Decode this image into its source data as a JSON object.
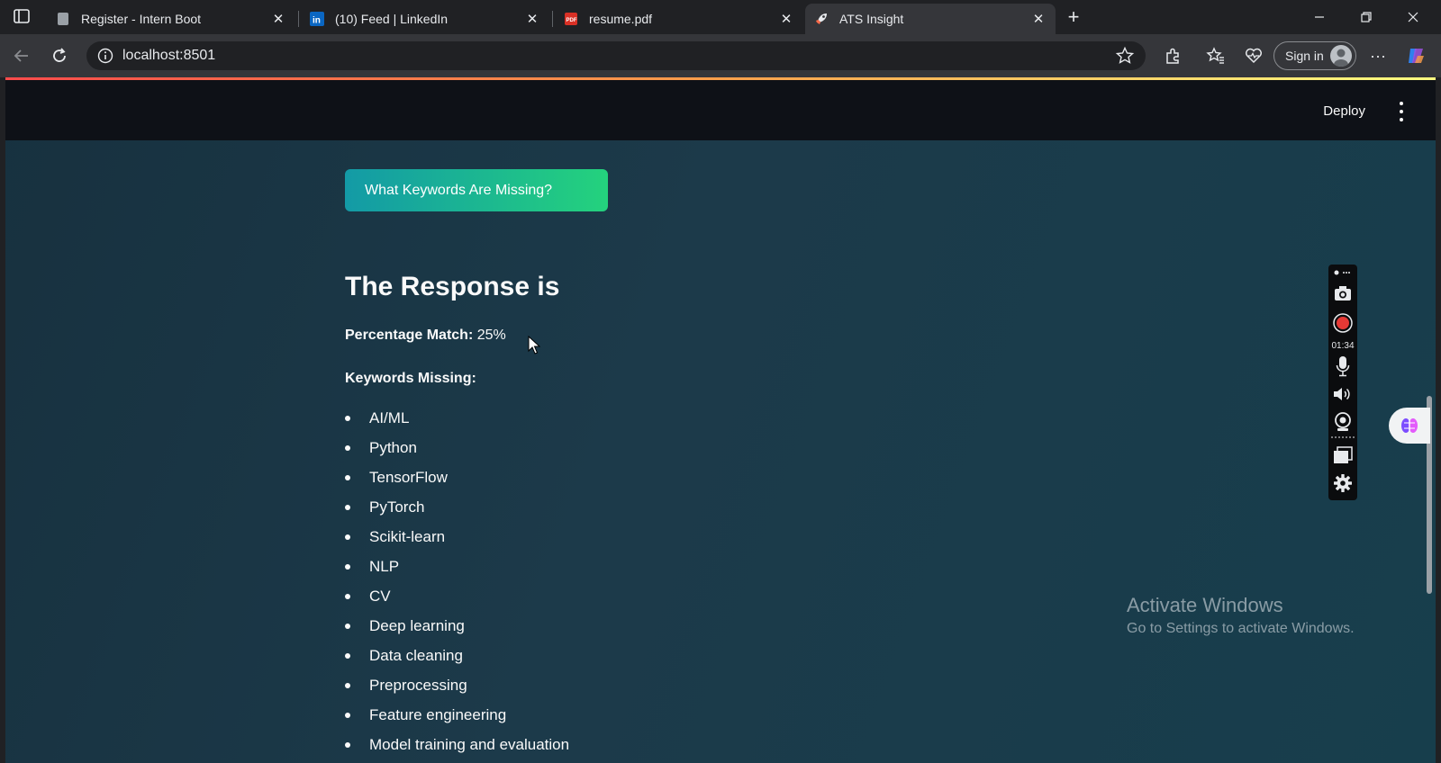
{
  "browser": {
    "tabs": [
      {
        "title": "Register - Intern Boot",
        "active": false
      },
      {
        "title": "(10) Feed | LinkedIn",
        "active": false
      },
      {
        "title": "resume.pdf",
        "active": false
      },
      {
        "title": "ATS Insight",
        "active": true
      }
    ],
    "url": "localhost:8501",
    "sign_in_label": "Sign in"
  },
  "app": {
    "deploy_label": "Deploy",
    "keywords_button": "What Keywords Are Missing?",
    "response_title": "The Response is",
    "percentage_label": "Percentage Match:",
    "percentage_value": "25%",
    "keywords_missing_label": "Keywords Missing:",
    "keywords": [
      "AI/ML",
      "Python",
      "TensorFlow",
      "PyTorch",
      "Scikit-learn",
      "NLP",
      "CV",
      "Deep learning",
      "Data cleaning",
      "Preprocessing",
      "Feature engineering",
      "Model training and evaluation"
    ]
  },
  "recorder": {
    "elapsed": "01:34"
  },
  "watermark": {
    "line1": "Activate Windows",
    "line2": "Go to Settings to activate Windows."
  },
  "colors": {
    "button_gradient_start": "#139aa6",
    "button_gradient_end": "#24d27d",
    "header_bg": "#0e1117",
    "record_red": "#e53935"
  }
}
